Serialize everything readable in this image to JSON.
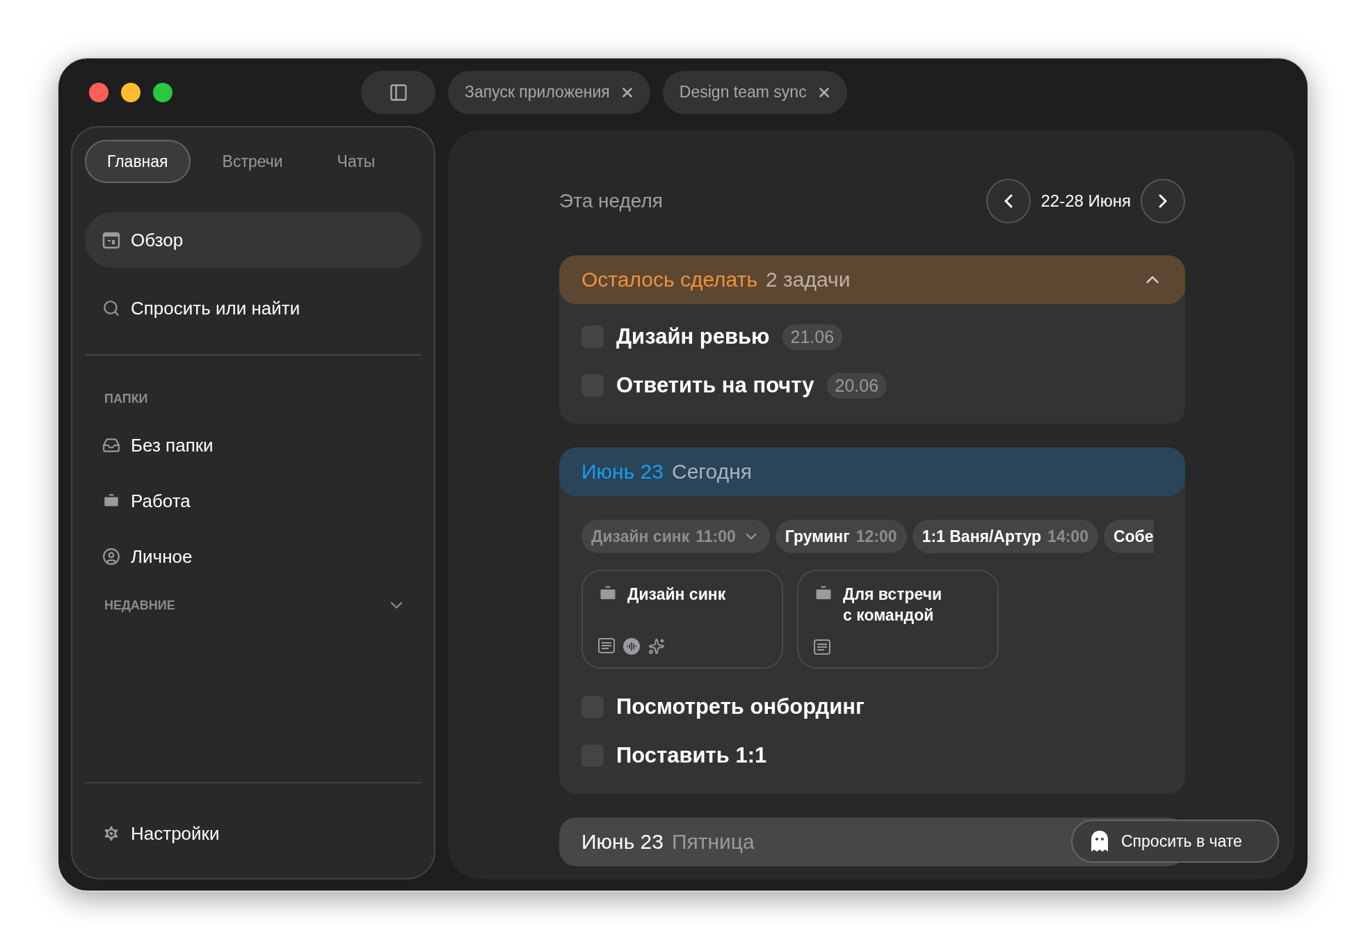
{
  "tabs": [
    {
      "label": "Запуск приложения",
      "selected": false
    },
    {
      "label": "Design team sync",
      "selected": false
    }
  ],
  "sidebar": {
    "segments": [
      {
        "label": "Главная",
        "selected": true
      },
      {
        "label": "Встречи",
        "selected": false
      },
      {
        "label": "Чаты",
        "selected": false
      }
    ],
    "nav": [
      {
        "label": "Обзор",
        "selected": true
      },
      {
        "label": "Спросить или найти",
        "selected": false
      }
    ],
    "folders_title": "ПАПКИ",
    "folders": [
      {
        "label": "Без папки"
      },
      {
        "label": "Работа"
      },
      {
        "label": "Личное"
      }
    ],
    "recent": {
      "title": "НЕДАВНИЕ",
      "expanded": false
    },
    "settings": "Настройки"
  },
  "main": {
    "heading": "Эта неделя",
    "range": "22-28 Июня",
    "pending": {
      "title": "Осталось сделать",
      "count": "2 задачи",
      "expanded": true,
      "tasks": [
        {
          "title": "Дизайн ревью",
          "date": "21.06",
          "checked": false
        },
        {
          "title": "Ответить на почту",
          "date": "20.06",
          "checked": false
        }
      ]
    },
    "days": [
      {
        "kind": "today",
        "date": "Июнь 23",
        "weekday": "Сегодня",
        "events": [
          {
            "title": "Дизайн синк",
            "time": "11:00",
            "past": true,
            "dropdown": true,
            "cut": false
          },
          {
            "title": "Груминг",
            "time": "12:00",
            "past": false,
            "dropdown": false,
            "cut": false
          },
          {
            "title": "1:1 Ваня/Артур",
            "time": "14:00",
            "past": false,
            "dropdown": false,
            "cut": false
          },
          {
            "title": "Собе",
            "past": false,
            "dropdown": false,
            "cut": true
          }
        ],
        "notes": [
          {
            "title": "Дизайн синк",
            "attachments": [
              {
                "kind": "notes"
              },
              {
                "kind": "audio"
              },
              {
                "kind": "ai"
              }
            ]
          },
          {
            "title": "Для встречи с командой",
            "attachments": [
              {
                "kind": "notes"
              }
            ]
          }
        ],
        "tasks": [
          {
            "title": "Посмотреть онбординг",
            "checked": false
          },
          {
            "title": "Поставить 1:1",
            "checked": false
          }
        ]
      },
      {
        "kind": "future",
        "date": "Июнь 23",
        "weekday": "Пятница"
      }
    ]
  },
  "chat_button": "Спросить в чате"
}
